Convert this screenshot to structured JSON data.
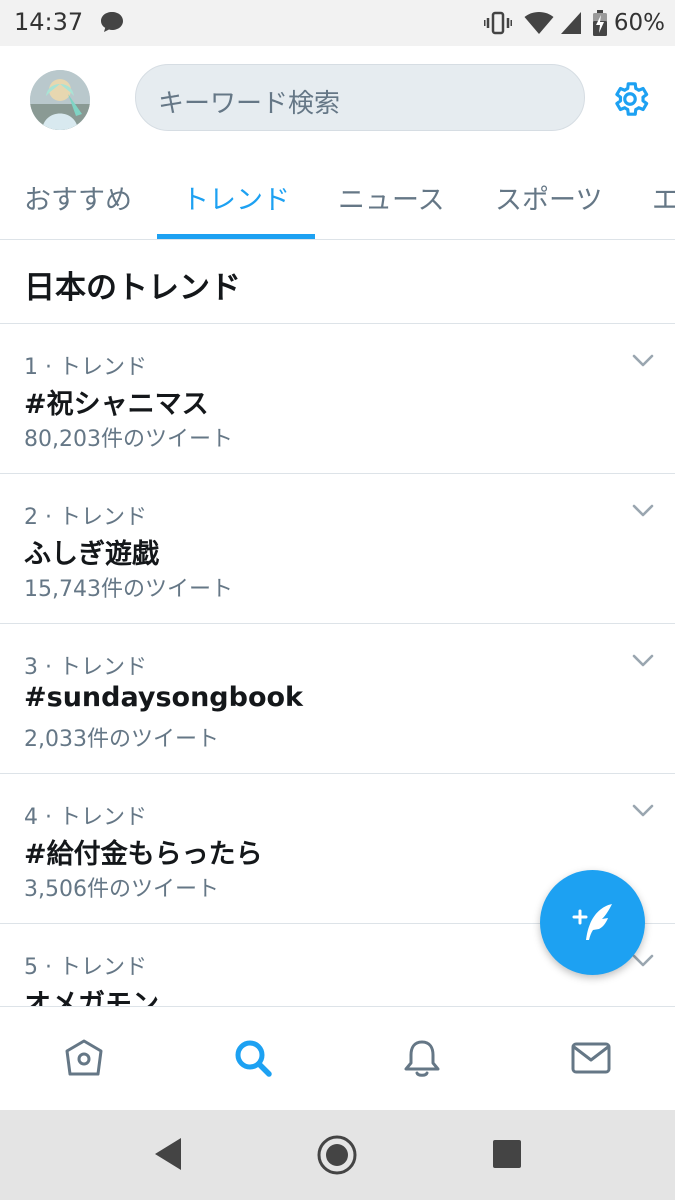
{
  "status_bar": {
    "time": "14:37",
    "battery_text": "60%",
    "icons": [
      "chat-bubble-icon",
      "vibrate-icon",
      "wifi-icon",
      "cellular-icon",
      "battery-charging-icon"
    ]
  },
  "header": {
    "avatar_icon": "avatar-image",
    "search_placeholder": "キーワード検索",
    "settings_icon": "gear-icon"
  },
  "tabs": [
    {
      "label": "おすすめ",
      "active": false
    },
    {
      "label": "トレンド",
      "active": true
    },
    {
      "label": "ニュース",
      "active": false
    },
    {
      "label": "スポーツ",
      "active": false
    },
    {
      "label": "エ",
      "active": false
    }
  ],
  "section": {
    "title": "日本のトレンド"
  },
  "trends": [
    {
      "meta": "1 · トレンド",
      "name": "#祝シャニマス",
      "count": "80,203件のツイート"
    },
    {
      "meta": "2 · トレンド",
      "name": "ふしぎ遊戯",
      "count": "15,743件のツイート"
    },
    {
      "meta": "3 · トレンド",
      "name": "#sundaysongbook",
      "count": "2,033件のツイート"
    },
    {
      "meta": "4 · トレンド",
      "name": "#給付金もらったら",
      "count": "3,506件のツイート"
    },
    {
      "meta": "5 · トレンド",
      "name": "オメガモン",
      "count": ""
    }
  ],
  "fab": {
    "icon": "compose-tweet-icon",
    "color": "#1da1f2"
  },
  "bottom_nav": {
    "items": [
      "home-icon",
      "search-icon",
      "bell-icon",
      "mail-icon"
    ],
    "active": "search-icon",
    "active_color": "#1da1f2",
    "inactive_color": "#657786"
  },
  "android_nav": [
    "back-icon",
    "home-circle-icon",
    "recents-icon"
  ]
}
